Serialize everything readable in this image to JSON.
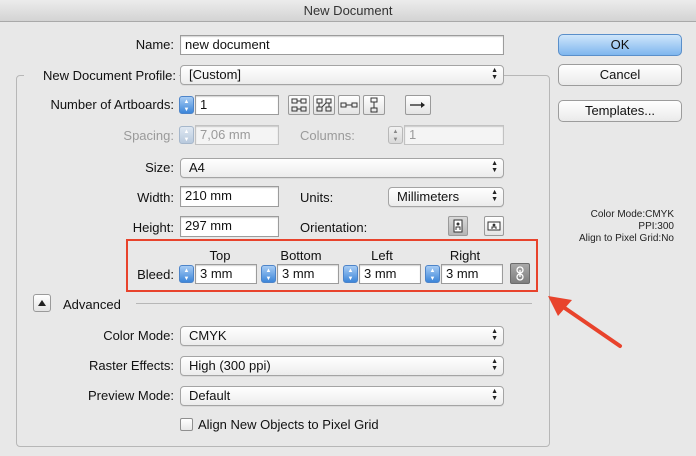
{
  "window": {
    "title": "New Document"
  },
  "name": {
    "label": "Name:",
    "value": "new document"
  },
  "profile": {
    "label": "New Document Profile:",
    "value": "[Custom]"
  },
  "artboards": {
    "label": "Number of Artboards:",
    "value": "1"
  },
  "spacing": {
    "label": "Spacing:",
    "value": "7,06 mm"
  },
  "columns": {
    "label": "Columns:",
    "value": "1"
  },
  "size": {
    "label": "Size:",
    "value": "A4"
  },
  "width": {
    "label": "Width:",
    "value": "210 mm"
  },
  "units": {
    "label": "Units:",
    "value": "Millimeters"
  },
  "height": {
    "label": "Height:",
    "value": "297 mm"
  },
  "orientation": {
    "label": "Orientation:"
  },
  "bleed": {
    "label": "Bleed:",
    "top_label": "Top",
    "top_value": "3 mm",
    "bottom_label": "Bottom",
    "bottom_value": "3 mm",
    "left_label": "Left",
    "left_value": "3 mm",
    "right_label": "Right",
    "right_value": "3 mm"
  },
  "advanced": {
    "label": "Advanced"
  },
  "color_mode": {
    "label": "Color Mode:",
    "value": "CMYK"
  },
  "raster_effects": {
    "label": "Raster Effects:",
    "value": "High (300 ppi)"
  },
  "preview_mode": {
    "label": "Preview Mode:",
    "value": "Default"
  },
  "align_pixel": {
    "label": "Align New Objects to Pixel Grid",
    "checked": false
  },
  "buttons": {
    "ok": "OK",
    "cancel": "Cancel",
    "templates": "Templates..."
  },
  "info": {
    "color_mode": "Color Mode:CMYK",
    "ppi": "PPI:300",
    "align": "Align to Pixel Grid:No"
  },
  "colors": {
    "highlight": "#e8432c",
    "default_button": "#7fb6ee"
  },
  "icons": [
    "grid-by-row-icon",
    "grid-by-column-icon",
    "arrange-by-row-icon",
    "arrange-by-column-icon",
    "right-to-left-icon",
    "portrait-icon",
    "landscape-icon",
    "link-icon"
  ]
}
